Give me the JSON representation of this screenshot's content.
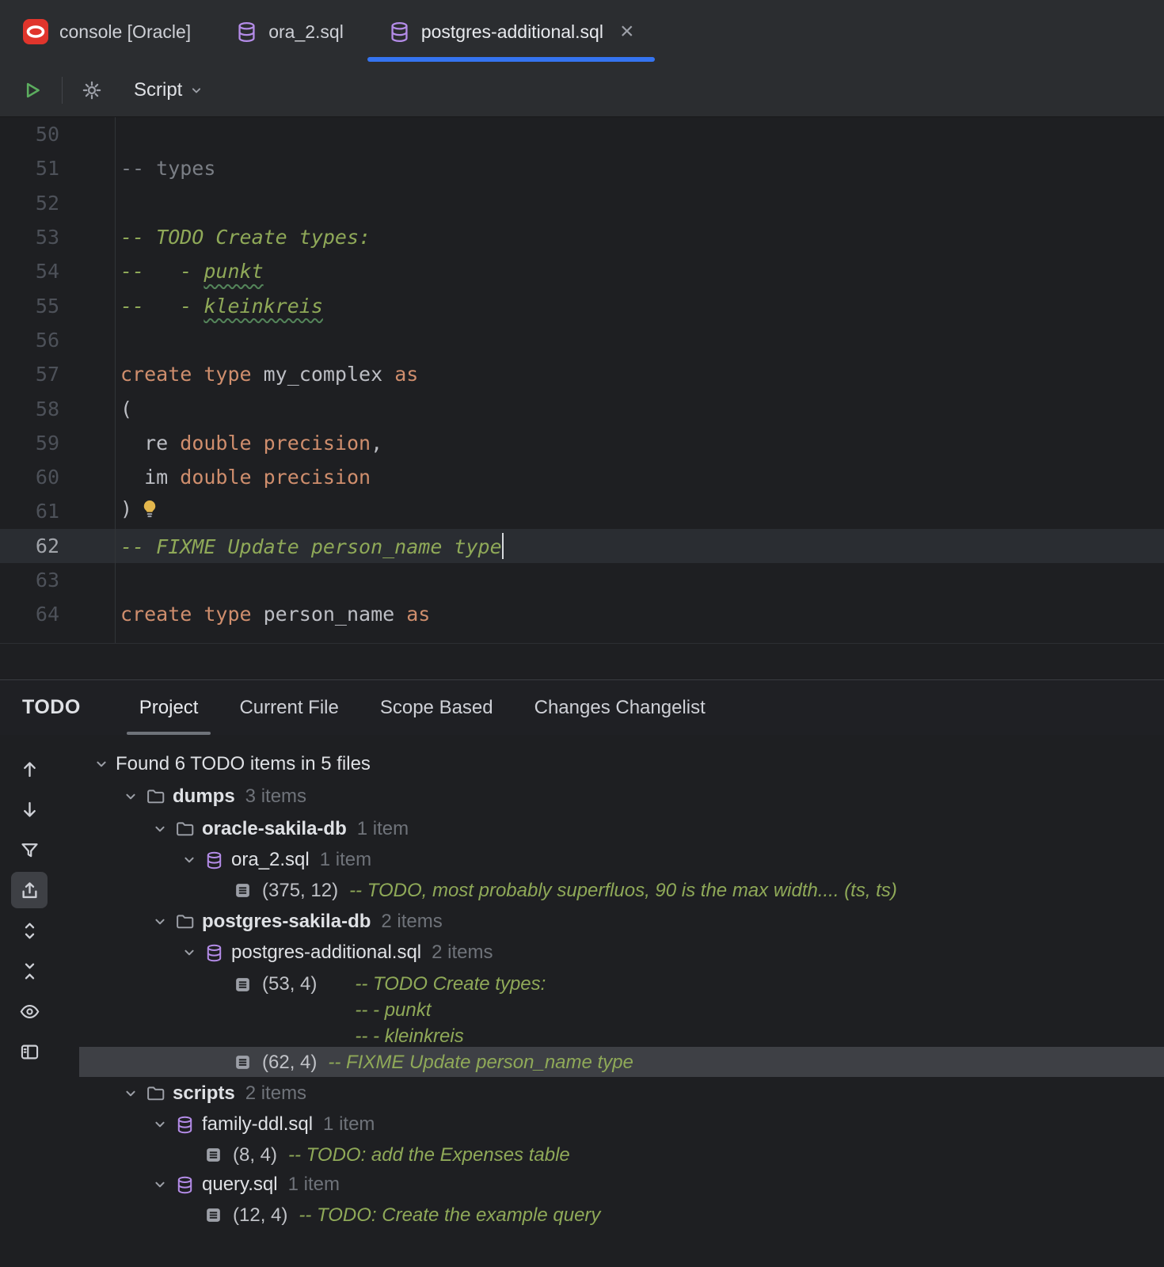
{
  "colors": {
    "accent_blue": "#3574f0",
    "keyword_orange": "#cf8e6d",
    "plain_text": "#bcbec4",
    "comment_gray": "#7a7e85",
    "todo_green": "#8fa958",
    "editor_bg": "#1e1f22",
    "bar_bg": "#2b2d30"
  },
  "tabbar": {
    "tabs": [
      {
        "label": "console [Oracle]",
        "icon": "oracle-icon",
        "active": false,
        "closable": false
      },
      {
        "label": "ora_2.sql",
        "icon": "database-icon",
        "active": false,
        "closable": false
      },
      {
        "label": "postgres-additional.sql",
        "icon": "database-icon",
        "active": true,
        "closable": true
      }
    ]
  },
  "toolbar": {
    "script_dropdown": "Script"
  },
  "editor": {
    "lines": [
      {
        "num": "50",
        "segments": []
      },
      {
        "num": "51",
        "segments": [
          {
            "text": "-- types",
            "style": "comment"
          }
        ]
      },
      {
        "num": "52",
        "segments": []
      },
      {
        "num": "53",
        "segments": [
          {
            "text": "-- TODO Create types:",
            "style": "todo"
          }
        ]
      },
      {
        "num": "54",
        "segments": [
          {
            "text": "--   - ",
            "style": "todo"
          },
          {
            "text": "punkt",
            "style": "todo",
            "wavy": true
          }
        ]
      },
      {
        "num": "55",
        "segments": [
          {
            "text": "--   - ",
            "style": "todo"
          },
          {
            "text": "kleinkreis",
            "style": "todo",
            "wavy": true
          }
        ]
      },
      {
        "num": "56",
        "segments": []
      },
      {
        "num": "57",
        "segments": [
          {
            "text": "create type",
            "style": "keyword"
          },
          {
            "text": " my_complex ",
            "style": "plain"
          },
          {
            "text": "as",
            "style": "keyword"
          }
        ]
      },
      {
        "num": "58",
        "segments": [
          {
            "text": "(",
            "style": "plain"
          }
        ]
      },
      {
        "num": "59",
        "segments": [
          {
            "text": "  re ",
            "style": "plain"
          },
          {
            "text": "double precision",
            "style": "keyword"
          },
          {
            "text": ",",
            "style": "plain"
          }
        ]
      },
      {
        "num": "60",
        "segments": [
          {
            "text": "  im ",
            "style": "plain"
          },
          {
            "text": "double precision",
            "style": "keyword"
          }
        ]
      },
      {
        "num": "61",
        "segments": [
          {
            "text": ")",
            "style": "plain"
          }
        ],
        "bulb": true
      },
      {
        "num": "62",
        "segments": [
          {
            "text": "-- FIXME Update person_name type",
            "style": "todo"
          }
        ],
        "current": true,
        "caret": true
      },
      {
        "num": "63",
        "segments": []
      },
      {
        "num": "64",
        "segments": [
          {
            "text": "create type",
            "style": "keyword"
          },
          {
            "text": " person_name ",
            "style": "plain"
          },
          {
            "text": "as",
            "style": "keyword"
          }
        ]
      }
    ]
  },
  "todo_panel": {
    "title": "TODO",
    "tabs": [
      {
        "label": "Project",
        "active": true
      },
      {
        "label": "Current File",
        "active": false
      },
      {
        "label": "Scope Based",
        "active": false
      },
      {
        "label": "Changes Changelist",
        "active": false
      }
    ],
    "toolbar_icons": [
      {
        "name": "up-arrow-icon",
        "selected": false
      },
      {
        "name": "down-arrow-icon",
        "selected": false
      },
      {
        "name": "filter-icon",
        "selected": false
      },
      {
        "name": "autoscroll-to-source-icon",
        "selected": true
      },
      {
        "name": "expand-all-icon",
        "selected": false
      },
      {
        "name": "collapse-all-icon",
        "selected": false
      },
      {
        "name": "preview-eye-icon",
        "selected": false
      },
      {
        "name": "layout-icon",
        "selected": false
      }
    ],
    "tree": [
      {
        "type": "summary",
        "level": 0,
        "text": "Found 6 TODO items in 5 files"
      },
      {
        "type": "folder",
        "level": 1,
        "name": "dumps",
        "count": "3 items"
      },
      {
        "type": "folder",
        "level": 2,
        "name": "oracle-sakila-db",
        "count": "1 item"
      },
      {
        "type": "file",
        "level": 3,
        "name": "ora_2.sql",
        "count": "1 item"
      },
      {
        "type": "item",
        "level": 4,
        "loc": "(375, 12)",
        "comment_lines": [
          "-- TODO, most probably superfluos, 90 is the max width.... (ts, ts)"
        ]
      },
      {
        "type": "folder",
        "level": 2,
        "name": "postgres-sakila-db",
        "count": "2 items"
      },
      {
        "type": "file",
        "level": 3,
        "name": "postgres-additional.sql",
        "count": "2 items"
      },
      {
        "type": "item",
        "level": 4,
        "loc": "(53, 4)",
        "comment_lines": [
          "-- TODO Create types:",
          "-- - punkt",
          "-- - kleinkreis"
        ],
        "wide_gap": true
      },
      {
        "type": "item",
        "level": 4,
        "loc": "(62, 4)",
        "comment_lines": [
          "-- FIXME Update person_name type"
        ],
        "selected": true
      },
      {
        "type": "folder",
        "level": 1,
        "name": "scripts",
        "count": "2 items"
      },
      {
        "type": "file",
        "level": 2,
        "name": "family-ddl.sql",
        "count": "1 item"
      },
      {
        "type": "item",
        "level": 3,
        "loc": "(8, 4)",
        "comment_lines": [
          "-- TODO: add the Expenses table"
        ]
      },
      {
        "type": "file",
        "level": 2,
        "name": "query.sql",
        "count": "1 item"
      },
      {
        "type": "item",
        "level": 3,
        "loc": "(12, 4)",
        "comment_lines": [
          "-- TODO: Create the example query"
        ]
      }
    ]
  }
}
